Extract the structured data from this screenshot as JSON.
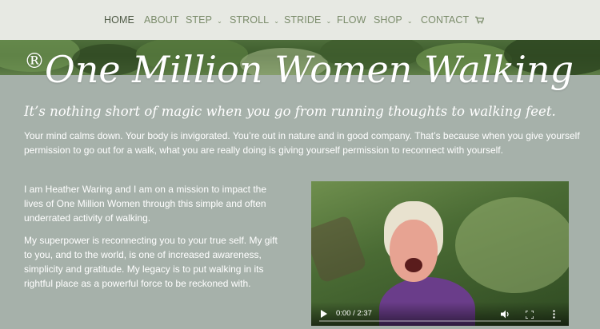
{
  "nav": {
    "items": [
      {
        "label": "HOME",
        "active": true,
        "dropdown": false
      },
      {
        "label": "ABOUT",
        "active": false,
        "dropdown": false
      },
      {
        "label": "STEP",
        "active": false,
        "dropdown": true
      },
      {
        "label": "STROLL",
        "active": false,
        "dropdown": true
      },
      {
        "label": "STRIDE",
        "active": false,
        "dropdown": true
      },
      {
        "label": "FLOW",
        "active": false,
        "dropdown": false
      },
      {
        "label": "SHOP",
        "active": false,
        "dropdown": true
      },
      {
        "label": "CONTACT",
        "active": false,
        "dropdown": false
      }
    ],
    "chevron": "⌄",
    "cart_icon": "shopping-cart-icon"
  },
  "hero": {
    "registered": "®",
    "title": "One Million Women Walking"
  },
  "content": {
    "tagline": "It’s nothing short of magic when you go from running thoughts to walking feet.",
    "intro": "Your mind calms down. Your body is invigorated. You’re out in nature and in good company. That’s because when you give yourself permission to go out for a walk, what you are really doing is giving yourself permission to reconnect with yourself.",
    "mission": "I am Heather Waring and I am on a mission to impact the lives of One Million Women through this simple and often underrated activity of walking.",
    "superpower": "My superpower is reconnecting you to your true self. My gift to you, and to the world, is one of increased awareness, simplicity and gratitude. My legacy is to put walking in its rightful place as a powerful force to be reckoned with."
  },
  "video": {
    "time": "0:00 / 2:37",
    "play_icon": "play-icon",
    "volume_icon": "volume-icon",
    "fullscreen_icon": "fullscreen-icon",
    "more_icon": "more-options-icon"
  },
  "colors": {
    "page_bg": "#a6b1aa",
    "nav_bg": "#e7e9e3",
    "nav_text": "#7b8c6b",
    "nav_active": "#4f5a46"
  }
}
